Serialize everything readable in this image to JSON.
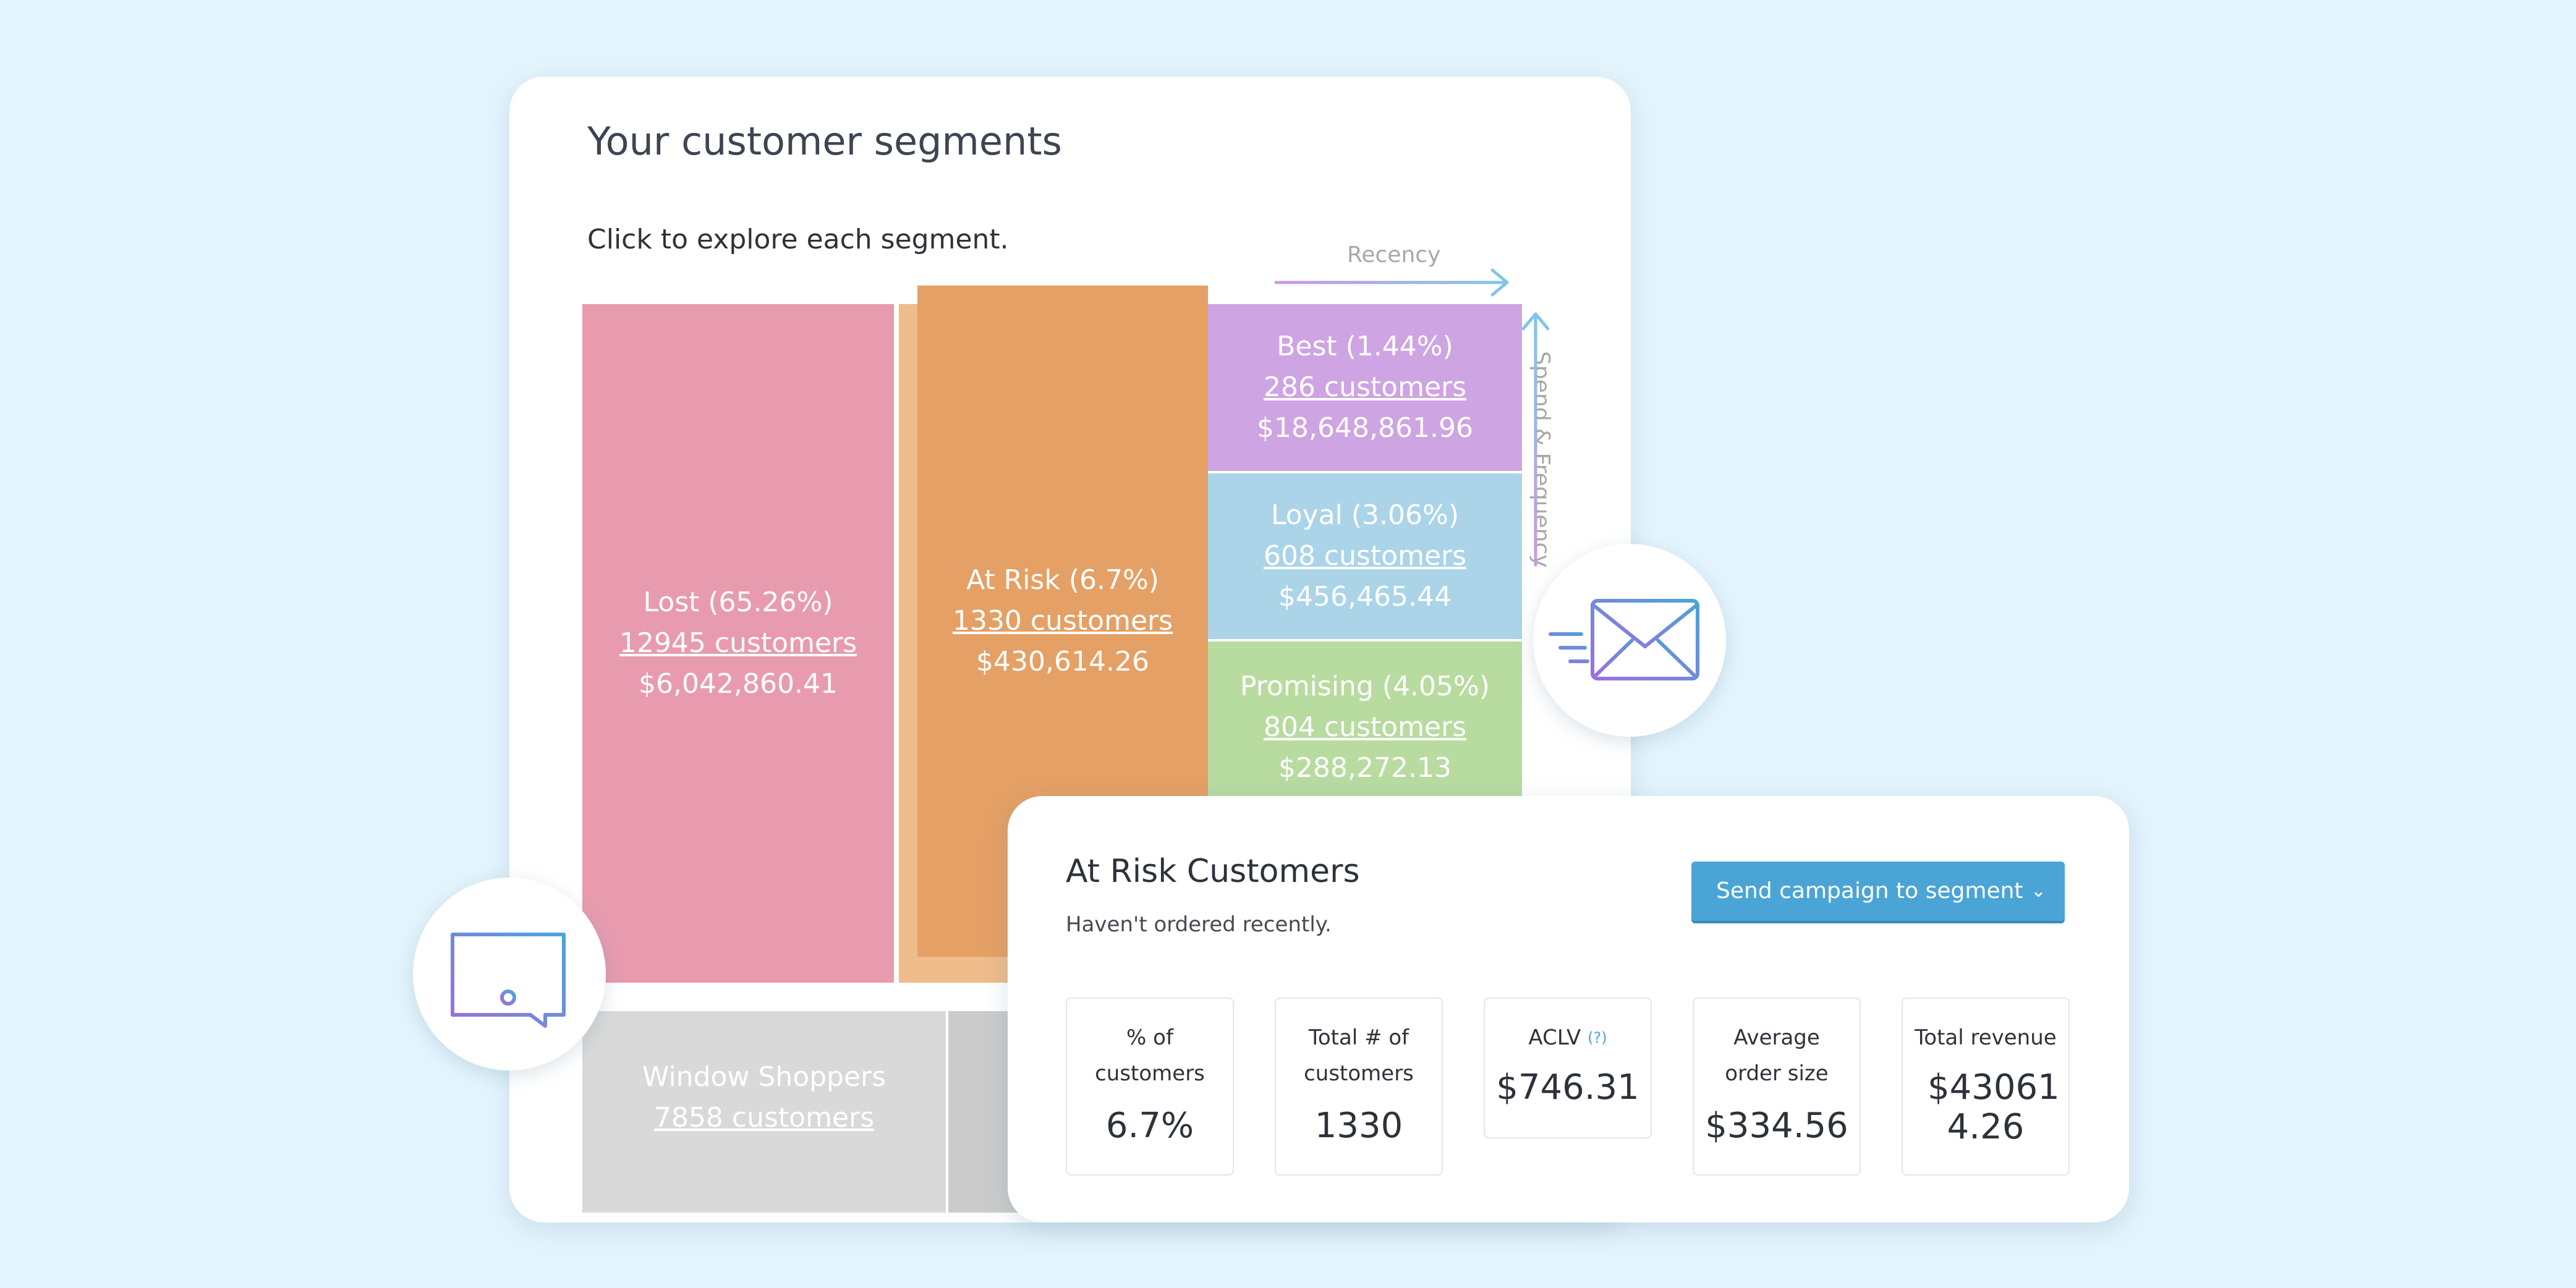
{
  "card": {
    "title": "Your customer segments",
    "subtitle": "Click to explore each segment.",
    "recency_label": "Recency",
    "spend_label": "Spend & Frequency",
    "segments": {
      "lost": {
        "name": "Lost (65.26%)",
        "customers": "12945 customers",
        "revenue": "$6,042,860.41"
      },
      "at_risk": {
        "name": "At Risk (6.7%)",
        "customers": "1330 customers",
        "revenue": "$430,614.26"
      },
      "best": {
        "name": "Best (1.44%)",
        "customers": "286 customers",
        "revenue": "$18,648,861.96"
      },
      "loyal": {
        "name": "Loyal (3.06%)",
        "customers": "608 customers",
        "revenue": "$456,465.44"
      },
      "promising": {
        "name": "Promising (4.05%)",
        "customers": "804 customers",
        "revenue": "$288,272.13"
      },
      "window_shoppers": {
        "name": "Window Shoppers",
        "customers": "7858 customers"
      }
    }
  },
  "detail": {
    "title": "At Risk Customers",
    "subtitle": "Haven't ordered recently.",
    "button_label": "Send campaign to segment",
    "stats": [
      {
        "label": "% of customers",
        "value": "6.7%"
      },
      {
        "label": "Total # of customers",
        "value": "1330"
      },
      {
        "label": "ACLV",
        "help": "(?)",
        "value": "$746.31"
      },
      {
        "label": "Average order size",
        "value": "$334.56"
      },
      {
        "label": "Total revenue",
        "value": "$43061 4.26"
      }
    ]
  },
  "icons": [
    "mail-icon",
    "alert-message-icon",
    "chevron-down-icon"
  ],
  "colors": {
    "lost": "#e89baf",
    "at_risk": "#e5a065",
    "best": "#cea4e2",
    "loyal": "#abd4e8",
    "promising": "#b8dba0",
    "window_shoppers": "#d9d9d9",
    "button": "#4aa5d6",
    "background": "#e3f4fc"
  }
}
